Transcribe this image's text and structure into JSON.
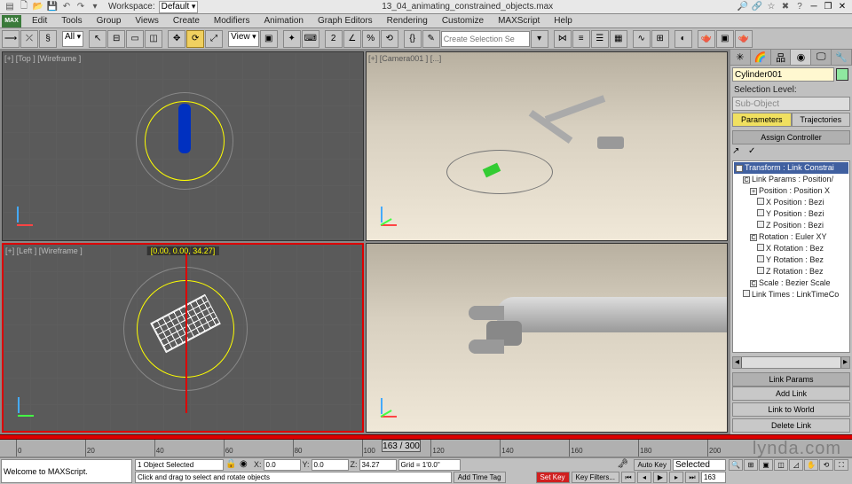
{
  "title": "13_04_animating_constrained_objects.max",
  "workspace": {
    "label": "Workspace:",
    "value": "Default"
  },
  "menu": [
    "Edit",
    "Tools",
    "Group",
    "Views",
    "Create",
    "Modifiers",
    "Animation",
    "Graph Editors",
    "Rendering",
    "Customize",
    "MAXScript",
    "Help"
  ],
  "toolbar": {
    "selection_filter": "All",
    "ref_coord": "View",
    "search_placeholder": "Create Selection Se"
  },
  "viewports": {
    "top": "[+] [Top ] [Wireframe ]",
    "camera": "[+] [Camera001 ] [...]",
    "left": "[+] [Left ] [Wireframe ]",
    "left_readout": "[0.00, 0.00, 34.27]",
    "persp": ""
  },
  "right_panel": {
    "object_name": "Cylinder001",
    "selection_level": "Selection Level:",
    "sub_object": "Sub-Object",
    "parameters": "Parameters",
    "trajectories": "Trajectories",
    "assign_controller": "Assign Controller",
    "tree": [
      {
        "t": "Transform : Link Constrai",
        "d": 0,
        "hl": true,
        "b": "-"
      },
      {
        "t": "Link Params : Position/",
        "d": 1,
        "hl": false,
        "b": "C"
      },
      {
        "t": "Position : Position X",
        "d": 2,
        "hl": false,
        "b": "+"
      },
      {
        "t": "X Position : Bezi",
        "d": 3,
        "hl": false,
        "b": ""
      },
      {
        "t": "Y Position : Bezi",
        "d": 3,
        "hl": false,
        "b": ""
      },
      {
        "t": "Z Position : Bezi",
        "d": 3,
        "hl": false,
        "b": ""
      },
      {
        "t": "Rotation : Euler XY",
        "d": 2,
        "hl": false,
        "b": "C"
      },
      {
        "t": "X Rotation : Bez",
        "d": 3,
        "hl": false,
        "b": ""
      },
      {
        "t": "Y Rotation : Bez",
        "d": 3,
        "hl": false,
        "b": ""
      },
      {
        "t": "Z Rotation : Bez",
        "d": 3,
        "hl": false,
        "b": ""
      },
      {
        "t": "Scale : Bezier Scale",
        "d": 2,
        "hl": false,
        "b": "C"
      },
      {
        "t": "Link Times : LinkTimeCo",
        "d": 1,
        "hl": false,
        "b": ""
      }
    ],
    "link_params": "Link Params",
    "add_link": "Add Link",
    "link_to_world": "Link to World",
    "delete_link": "Delete Link"
  },
  "timeline": {
    "slider": "163 / 300",
    "ticks": [
      "0",
      "20",
      "40",
      "60",
      "80",
      "100",
      "120",
      "140",
      "160",
      "180",
      "200"
    ]
  },
  "status": {
    "maxscript": "Welcome to MAXScript.",
    "selected": "1 Object Selected",
    "hint": "Click and drag to select and rotate objects",
    "x_label": "X:",
    "x": "0.0",
    "y_label": "Y:",
    "y": "0.0",
    "z_label": "Z:",
    "z": "34.27",
    "grid": "Grid = 1'0.0\"",
    "add_time_tag": "Add Time Tag",
    "auto_key": "Auto Key",
    "set_key": "Set Key",
    "selected_mode": "Selected",
    "key_filters": "Key Filters...",
    "frame": "163"
  },
  "watermark": "lynda.com"
}
